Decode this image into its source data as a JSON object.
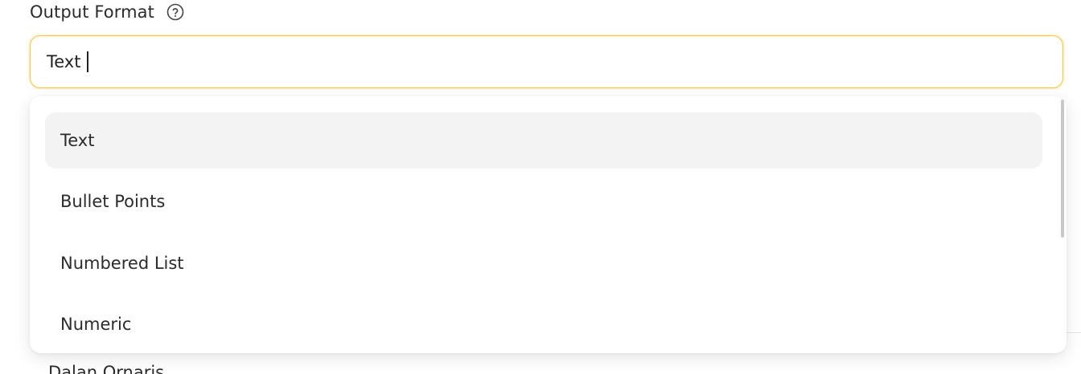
{
  "field": {
    "label": "Output Format",
    "help_icon": "question-circle-icon",
    "input_value": "Text",
    "focus_color": "#f5c542"
  },
  "dropdown": {
    "options": [
      {
        "label": "Text",
        "highlighted": true
      },
      {
        "label": "Bullet Points",
        "highlighted": false
      },
      {
        "label": "Numbered List",
        "highlighted": false
      },
      {
        "label": "Numeric",
        "highlighted": false
      }
    ]
  },
  "background": {
    "next_field_label": "Dalan Ornaris"
  }
}
